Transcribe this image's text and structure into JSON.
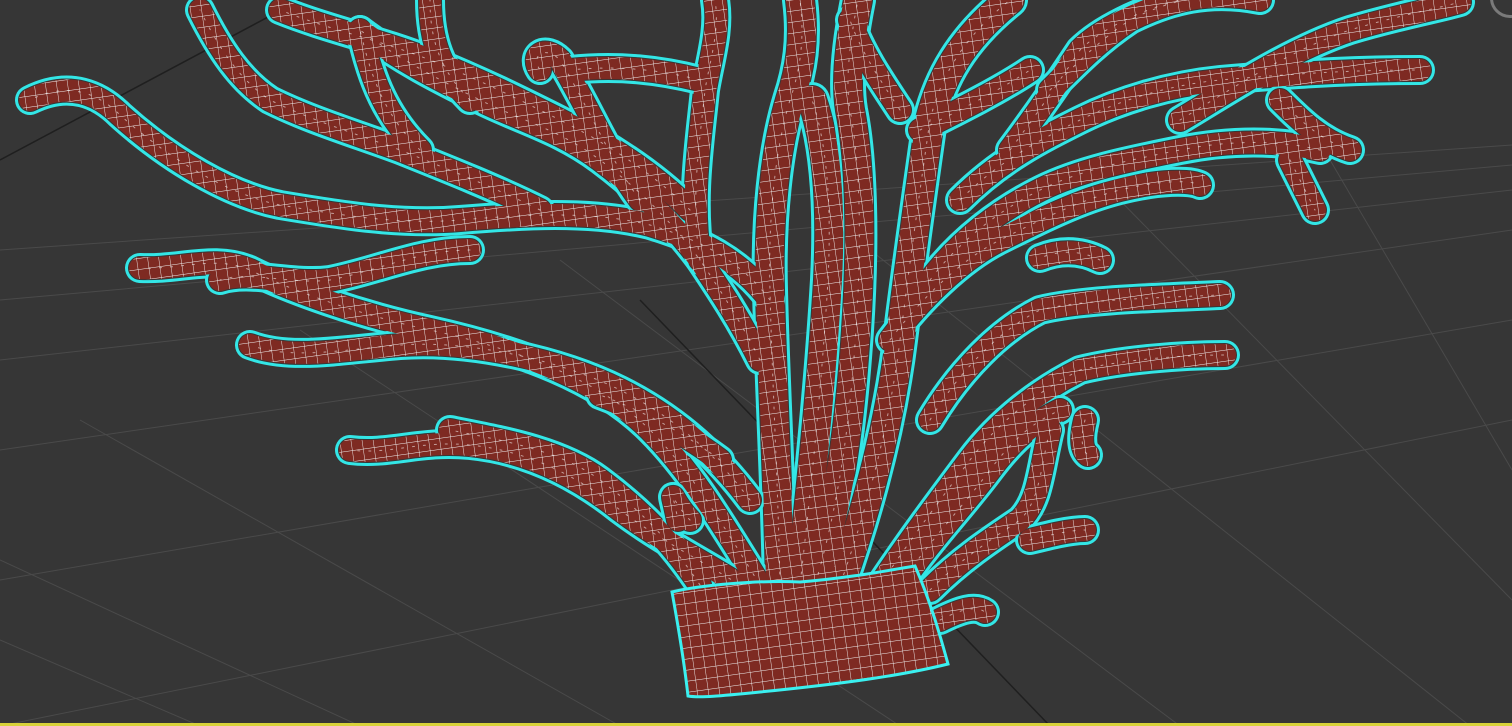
{
  "viewport": {
    "mode": "perspective",
    "shading": "edged-faces",
    "grid": true,
    "selected": true
  },
  "colors": {
    "background": "#363636",
    "grid": "#4a4a4a",
    "axis": "#1f1f1f",
    "mesh_fill": "#7e2a22",
    "mesh_wire": "#ffffff",
    "selection_outline": "#33e6e6",
    "border": "#d8d23a"
  },
  "model": {
    "name": "",
    "type": "coral"
  },
  "icons": {
    "nav_gizmo": "viewcube-ring-icon"
  }
}
